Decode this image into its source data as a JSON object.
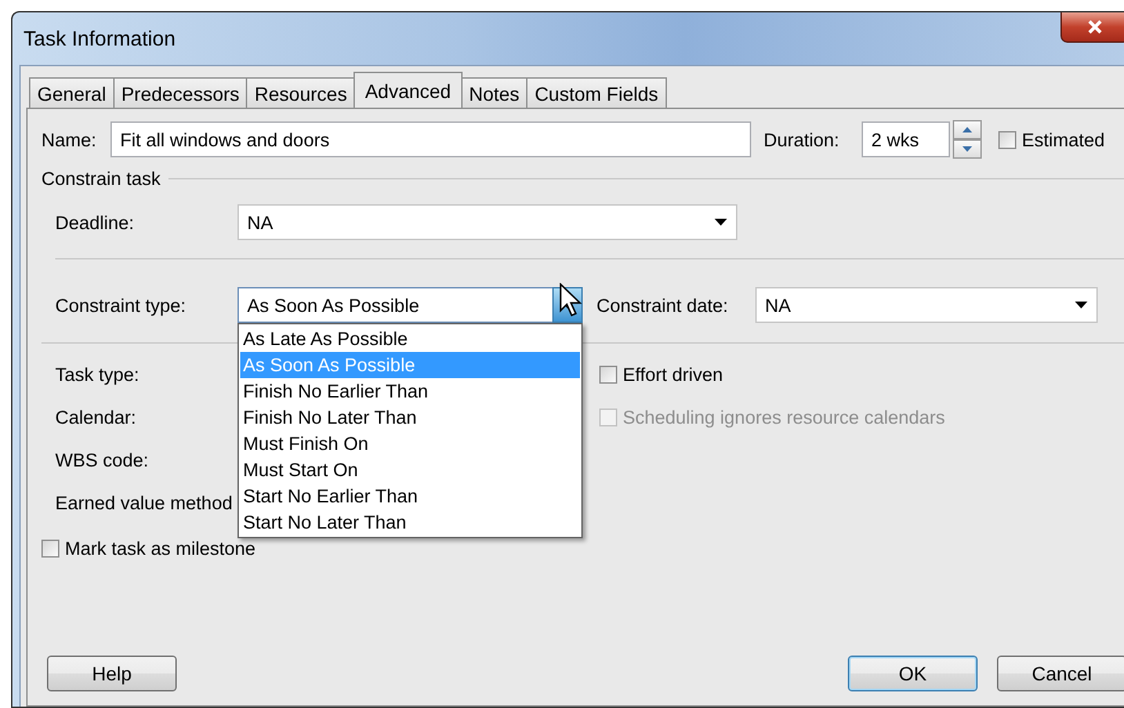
{
  "window": {
    "title": "Task Information"
  },
  "tabs": [
    {
      "label": "General",
      "selected": false
    },
    {
      "label": "Predecessors",
      "selected": false
    },
    {
      "label": "Resources",
      "selected": false
    },
    {
      "label": "Advanced",
      "selected": true
    },
    {
      "label": "Notes",
      "selected": false
    },
    {
      "label": "Custom Fields",
      "selected": false
    }
  ],
  "name": {
    "label": "Name:",
    "value": "Fit all windows and doors"
  },
  "duration": {
    "label": "Duration:",
    "value": "2 wks"
  },
  "estimated": {
    "label": "Estimated",
    "checked": false
  },
  "constrain_task": {
    "title": "Constrain task"
  },
  "deadline": {
    "label": "Deadline:",
    "value": "NA"
  },
  "constraint_type": {
    "label": "Constraint type:",
    "value": "As Soon As Possible",
    "expanded": true,
    "options": [
      {
        "label": "As Late As Possible",
        "selected": false
      },
      {
        "label": "As Soon As Possible",
        "selected": true
      },
      {
        "label": "Finish No Earlier Than",
        "selected": false
      },
      {
        "label": "Finish No Later Than",
        "selected": false
      },
      {
        "label": "Must Finish On",
        "selected": false
      },
      {
        "label": "Must Start On",
        "selected": false
      },
      {
        "label": "Start No Earlier Than",
        "selected": false
      },
      {
        "label": "Start No Later Than",
        "selected": false
      }
    ]
  },
  "constraint_date": {
    "label": "Constraint date:",
    "value": "NA"
  },
  "task_type": {
    "label": "Task type:"
  },
  "calendar": {
    "label": "Calendar:"
  },
  "wbs_code": {
    "label": "WBS code:"
  },
  "earned_value_method": {
    "label": "Earned value method"
  },
  "effort_driven": {
    "label": "Effort driven",
    "checked": false,
    "disabled": false
  },
  "scheduling_ignores": {
    "label": "Scheduling ignores resource calendars",
    "checked": false,
    "disabled": true
  },
  "milestone": {
    "label": "Mark task as milestone",
    "checked": false
  },
  "buttons": {
    "help": "Help",
    "ok": "OK",
    "cancel": "Cancel"
  }
}
